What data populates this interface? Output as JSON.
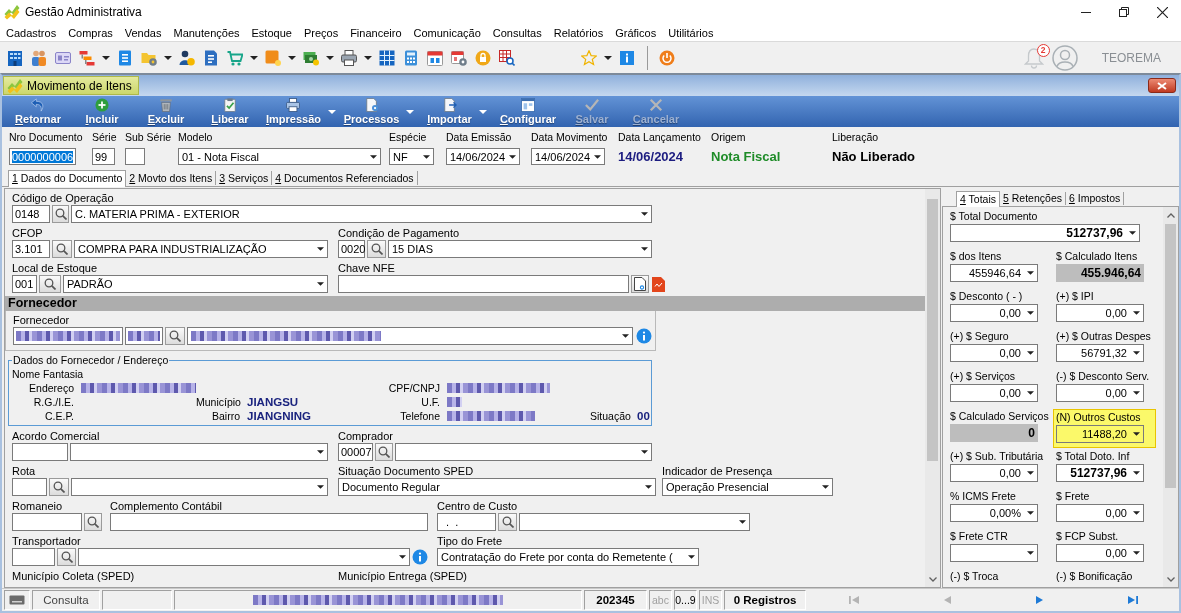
{
  "window": {
    "title": "Gestão Administrativa"
  },
  "menu": [
    "Cadastros",
    "Compras",
    "Vendas",
    "Manutenções",
    "Estoque",
    "Preços",
    "Financeiro",
    "Comunicação",
    "Consultas",
    "Relatórios",
    "Gráficos",
    "Utilitários"
  ],
  "account": {
    "notifications": "2",
    "user": "TEOREMA"
  },
  "child_window": {
    "title": "Movimento de Itens"
  },
  "actions": [
    {
      "label": "Retornar",
      "disabled": false,
      "dropdown": false
    },
    {
      "label": "Incluir",
      "disabled": false,
      "dropdown": false
    },
    {
      "label": "Excluir",
      "disabled": false,
      "dropdown": false
    },
    {
      "label": "Liberar",
      "disabled": false,
      "dropdown": false
    },
    {
      "label": "Impressão",
      "disabled": false,
      "dropdown": true
    },
    {
      "label": "Processos",
      "disabled": false,
      "dropdown": true
    },
    {
      "label": "Importar",
      "disabled": false,
      "dropdown": true
    },
    {
      "label": "Configurar",
      "disabled": false,
      "dropdown": false
    },
    {
      "label": "Salvar",
      "disabled": true,
      "dropdown": false
    },
    {
      "label": "Cancelar",
      "disabled": true,
      "dropdown": false
    }
  ],
  "header": [
    {
      "kind": "input",
      "label": "Nro Documento",
      "value": "0000000006",
      "highlighted": true
    },
    {
      "kind": "input",
      "label": "Série",
      "value": "99",
      "highlighted": false
    },
    {
      "kind": "input",
      "label": "Sub Série"
    },
    {
      "kind": "combo",
      "label": "Modelo",
      "value": "01 - Nota Fiscal"
    },
    {
      "kind": "combo",
      "label": "Espécie",
      "value": "NF"
    },
    {
      "kind": "combo",
      "label": "Data Emissão",
      "value": "14/06/2024"
    },
    {
      "kind": "combo",
      "label": "Data Movimento",
      "value": "14/06/2024"
    },
    {
      "kind": "display",
      "label": "Data Lançamento",
      "value": "14/06/2024",
      "color": "#1c1c80"
    },
    {
      "kind": "display",
      "label": "Origem",
      "value": "Nota Fiscal",
      "color": "#1e8c28"
    },
    {
      "kind": "display",
      "label": "Liberação",
      "value": "Não Liberado",
      "color": "#000000"
    }
  ],
  "tabs": [
    {
      "label": "1 Dados do Documento",
      "selected": true
    },
    {
      "label": "2 Movto dos Itens",
      "selected": false
    },
    {
      "label": "3 Serviços",
      "selected": false
    },
    {
      "label": "4 Documentos Referenciados",
      "selected": false
    }
  ],
  "document": {
    "rows_top": [
      [
        {
          "label": "Código de Operação",
          "controls": [
            {
              "kind": "input",
              "value": "0148"
            },
            {
              "kind": "search"
            },
            {
              "kind": "combo",
              "value": "C. MATERIA PRIMA - EXTERIOR"
            }
          ]
        }
      ],
      [
        {
          "label": "CFOP",
          "controls": [
            {
              "kind": "input",
              "value": "3.101"
            },
            {
              "kind": "search"
            },
            {
              "kind": "combo",
              "value": "COMPRA PARA INDUSTRIALIZAÇÃO"
            }
          ]
        },
        {
          "label": "Condição de Pagamento",
          "controls": [
            {
              "kind": "input",
              "value": "0020"
            },
            {
              "kind": "search"
            },
            {
              "kind": "combo",
              "value": "15 DIAS"
            }
          ]
        }
      ],
      [
        {
          "label": "Local de Estoque",
          "controls": [
            {
              "kind": "input",
              "value": "001"
            },
            {
              "kind": "search"
            },
            {
              "kind": "combo",
              "value": "PADRÃO"
            }
          ]
        },
        {
          "label": "Chave NFE",
          "controls": [
            {
              "kind": "input"
            },
            {
              "kind": "link"
            },
            {
              "kind": "pdf"
            }
          ]
        }
      ]
    ],
    "supplier": {
      "title": "Fornecedor",
      "fields": [
        {
          "label": "Fornecedor",
          "controls": [
            {
              "kind": "blurred_input"
            },
            {
              "kind": "blurred_input"
            },
            {
              "kind": "search"
            },
            {
              "kind": "blurred_combo"
            },
            {
              "kind": "info"
            }
          ]
        }
      ]
    },
    "address": {
      "title": "Dados do Fornecedor / Endereço",
      "trade_name_label": "Nome Fantasia",
      "lines": [
        [
          {
            "label": "Endereço",
            "kind": "blurred"
          },
          {
            "label": "CPF/CNPJ",
            "kind": "blurred"
          }
        ],
        [
          {
            "label": "R.G./I.E.",
            "kind": "label"
          },
          {
            "label": "Município",
            "kind": "text",
            "value": "JIANGSU"
          },
          {
            "label": "U.F.",
            "kind": "blurred"
          }
        ],
        [
          {
            "label": "C.E.P.",
            "kind": "label"
          },
          {
            "label": "Bairro",
            "kind": "text",
            "value": "JIANGNING"
          },
          {
            "label": "Telefone",
            "kind": "blurred"
          },
          {
            "label": "Situação",
            "kind": "text",
            "value": "00"
          }
        ]
      ]
    },
    "rows_bottom": [
      [
        {
          "label": "Acordo Comercial",
          "controls": [
            {
              "kind": "input"
            },
            {
              "kind": "combo"
            }
          ]
        },
        {
          "label": "Comprador",
          "controls": [
            {
              "kind": "input",
              "value": "00007"
            },
            {
              "kind": "search"
            },
            {
              "kind": "combo"
            }
          ]
        }
      ],
      [
        {
          "label": "Rota",
          "controls": [
            {
              "kind": "input"
            },
            {
              "kind": "search"
            },
            {
              "kind": "combo"
            }
          ]
        },
        {
          "label": "Situação Documento SPED",
          "controls": [
            {
              "kind": "combo",
              "value": "Documento Regular"
            }
          ]
        },
        {
          "label": "Indicador de Presença",
          "controls": [
            {
              "kind": "combo",
              "value": "Operação Presencial"
            }
          ]
        }
      ],
      [
        {
          "label": "Romaneio",
          "controls": [
            {
              "kind": "input"
            },
            {
              "kind": "search"
            }
          ]
        },
        {
          "label": "Complemento Contábil",
          "controls": [
            {
              "kind": "input"
            }
          ]
        },
        {
          "label": "Centro de Custo",
          "controls": [
            {
              "kind": "input",
              "value": "  .  ."
            },
            {
              "kind": "search"
            },
            {
              "kind": "combo"
            }
          ]
        }
      ],
      [
        {
          "label": "Transportador",
          "controls": [
            {
              "kind": "input"
            },
            {
              "kind": "search"
            },
            {
              "kind": "combo"
            },
            {
              "kind": "info"
            }
          ]
        },
        {
          "label": "Tipo do Frete",
          "controls": [
            {
              "kind": "combo",
              "value": "Contratação do Frete por conta do Remetente ("
            }
          ]
        }
      ],
      [
        {
          "label": "Município Coleta (SPED)"
        },
        {
          "label": "Município Entrega (SPED)"
        }
      ]
    ]
  },
  "totals": {
    "tabs": [
      {
        "label": "4 Totais",
        "selected": true
      },
      {
        "label": "5 Retenções",
        "selected": false
      },
      {
        "label": "6 Impostos",
        "selected": false
      }
    ],
    "rows": [
      [
        {
          "label": "$ Total Documento",
          "kind": "combo",
          "value": "512737,96",
          "bold": true,
          "highlighted": false
        }
      ],
      [
        {
          "label": "$ dos Itens",
          "kind": "combo",
          "value": "455946,64",
          "bold": false,
          "highlighted": false
        },
        {
          "label": "$ Calculado Itens",
          "kind": "readonly",
          "value": "455.946,64",
          "bold": true
        }
      ],
      [
        {
          "label": "$ Desconto ( - )",
          "kind": "combo",
          "value": "0,00",
          "bold": false,
          "highlighted": false
        },
        {
          "label": "(+) $ IPI",
          "kind": "combo",
          "value": "0,00",
          "bold": false,
          "highlighted": false
        }
      ],
      [
        {
          "label": "(+) $ Seguro",
          "kind": "combo",
          "value": "0,00",
          "bold": false,
          "highlighted": false
        },
        {
          "label": "(+) $ Outras Despes",
          "kind": "combo",
          "value": "56791,32",
          "bold": false,
          "highlighted": false
        }
      ],
      [
        {
          "label": "(+) $ Serviços",
          "kind": "combo",
          "value": "0,00",
          "bold": false,
          "highlighted": false
        },
        {
          "label": "(-) $ Desconto Serv.",
          "kind": "combo",
          "value": "0,00",
          "bold": false,
          "highlighted": false
        }
      ],
      [
        {
          "label": "$ Calculado Serviços",
          "kind": "readonly",
          "value": "0",
          "bold": true
        },
        {
          "label": "(N) Outros Custos",
          "kind": "combo",
          "value": "11488,20",
          "bold": false,
          "highlighted": true
        }
      ],
      [
        {
          "label": "(+) $ Sub. Tributária",
          "kind": "combo",
          "value": "0,00",
          "bold": false,
          "highlighted": false
        },
        {
          "label": "$ Total Doto. Inf",
          "kind": "combo",
          "value": "512737,96",
          "bold": true,
          "highlighted": false
        }
      ],
      [
        {
          "label": "% ICMS Frete",
          "kind": "combo",
          "value": "0,00%",
          "bold": false,
          "highlighted": false
        },
        {
          "label": "$ Frete",
          "kind": "combo",
          "value": "0,00",
          "bold": false,
          "highlighted": false
        }
      ],
      [
        {
          "label": "$ Frete CTR",
          "kind": "combo",
          "highlighted": false
        },
        {
          "label": "$ FCP Subst.",
          "kind": "combo",
          "value": "0,00",
          "bold": false,
          "highlighted": false
        }
      ],
      [
        {
          "label": "(-) $ Troca",
          "kind": "label"
        },
        {
          "label": "(-) $ Bonificação",
          "kind": "label"
        }
      ]
    ]
  },
  "status_bar": {
    "mode": "Consulta",
    "record": "202345",
    "indicators": [
      {
        "label": "abc",
        "active": false
      },
      {
        "label": "0...9",
        "active": true
      },
      {
        "label": "INS",
        "active": false
      }
    ],
    "count": "0 Registros",
    "navigation": [
      {
        "disabled": true
      },
      {
        "disabled": true
      },
      {
        "disabled": false
      },
      {
        "disabled": false
      }
    ]
  }
}
